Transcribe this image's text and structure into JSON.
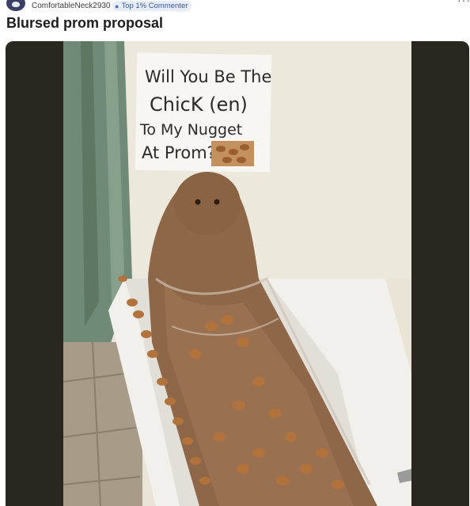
{
  "post": {
    "author": "ComfortableNeck2930",
    "badge_label": "Top 1% Commenter",
    "badge_icon": "commenter-badge-icon",
    "more_icon": "ellipsis-icon",
    "title": "Blursed prom proposal"
  },
  "image": {
    "sign_lines": [
      "Will You Be The",
      "ChicK (en)",
      "To My  Nugget",
      "At Prom?"
    ]
  }
}
